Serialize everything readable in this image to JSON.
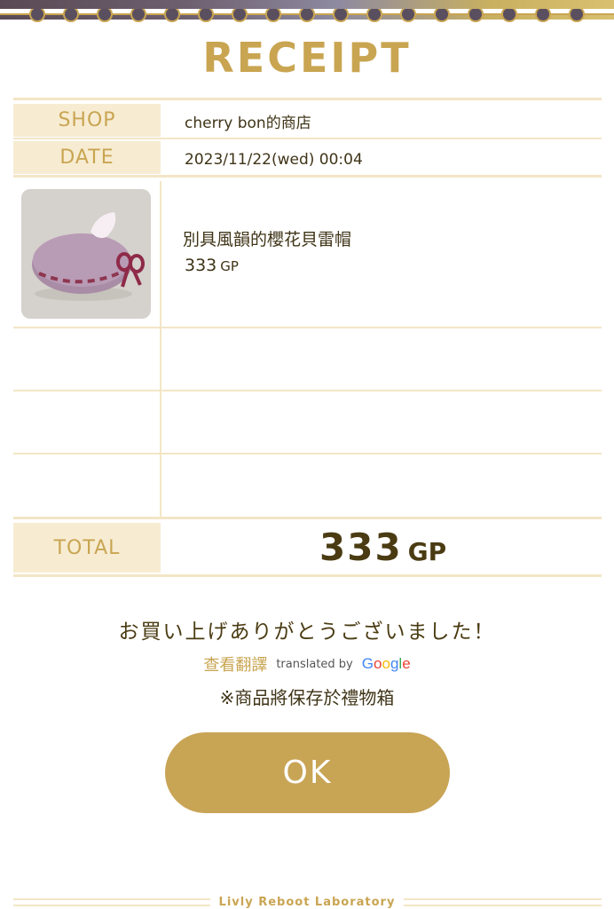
{
  "receipt": {
    "title": "RECEIPT",
    "shop_label": "SHOP",
    "shop_value": "cherry bon的商店",
    "date_label": "DATE",
    "date_value": "2023/11/22(wed) 00:04"
  },
  "item": {
    "name": "別具風韻的櫻花貝雷帽",
    "price": "333",
    "unit": "GP"
  },
  "total": {
    "label": "TOTAL",
    "value": "333",
    "unit": "GP"
  },
  "messages": {
    "thanks": "お買い上げありがとうございました！",
    "translate_link": "查看翻譯",
    "translated_by": "translated by",
    "google": "Google",
    "gift_note": "※商品將保存於禮物箱"
  },
  "buttons": {
    "ok_label": "OK"
  },
  "footer": {
    "text": "Livly Reboot Laboratory"
  },
  "colors": {
    "accent_gold": "#c9a552",
    "label_bg": "#f7ecd2",
    "button_bg": "#c8a455",
    "text_dark": "#4a3b12"
  },
  "icons": {
    "item_thumbnail": "sakura-beret-icon"
  }
}
